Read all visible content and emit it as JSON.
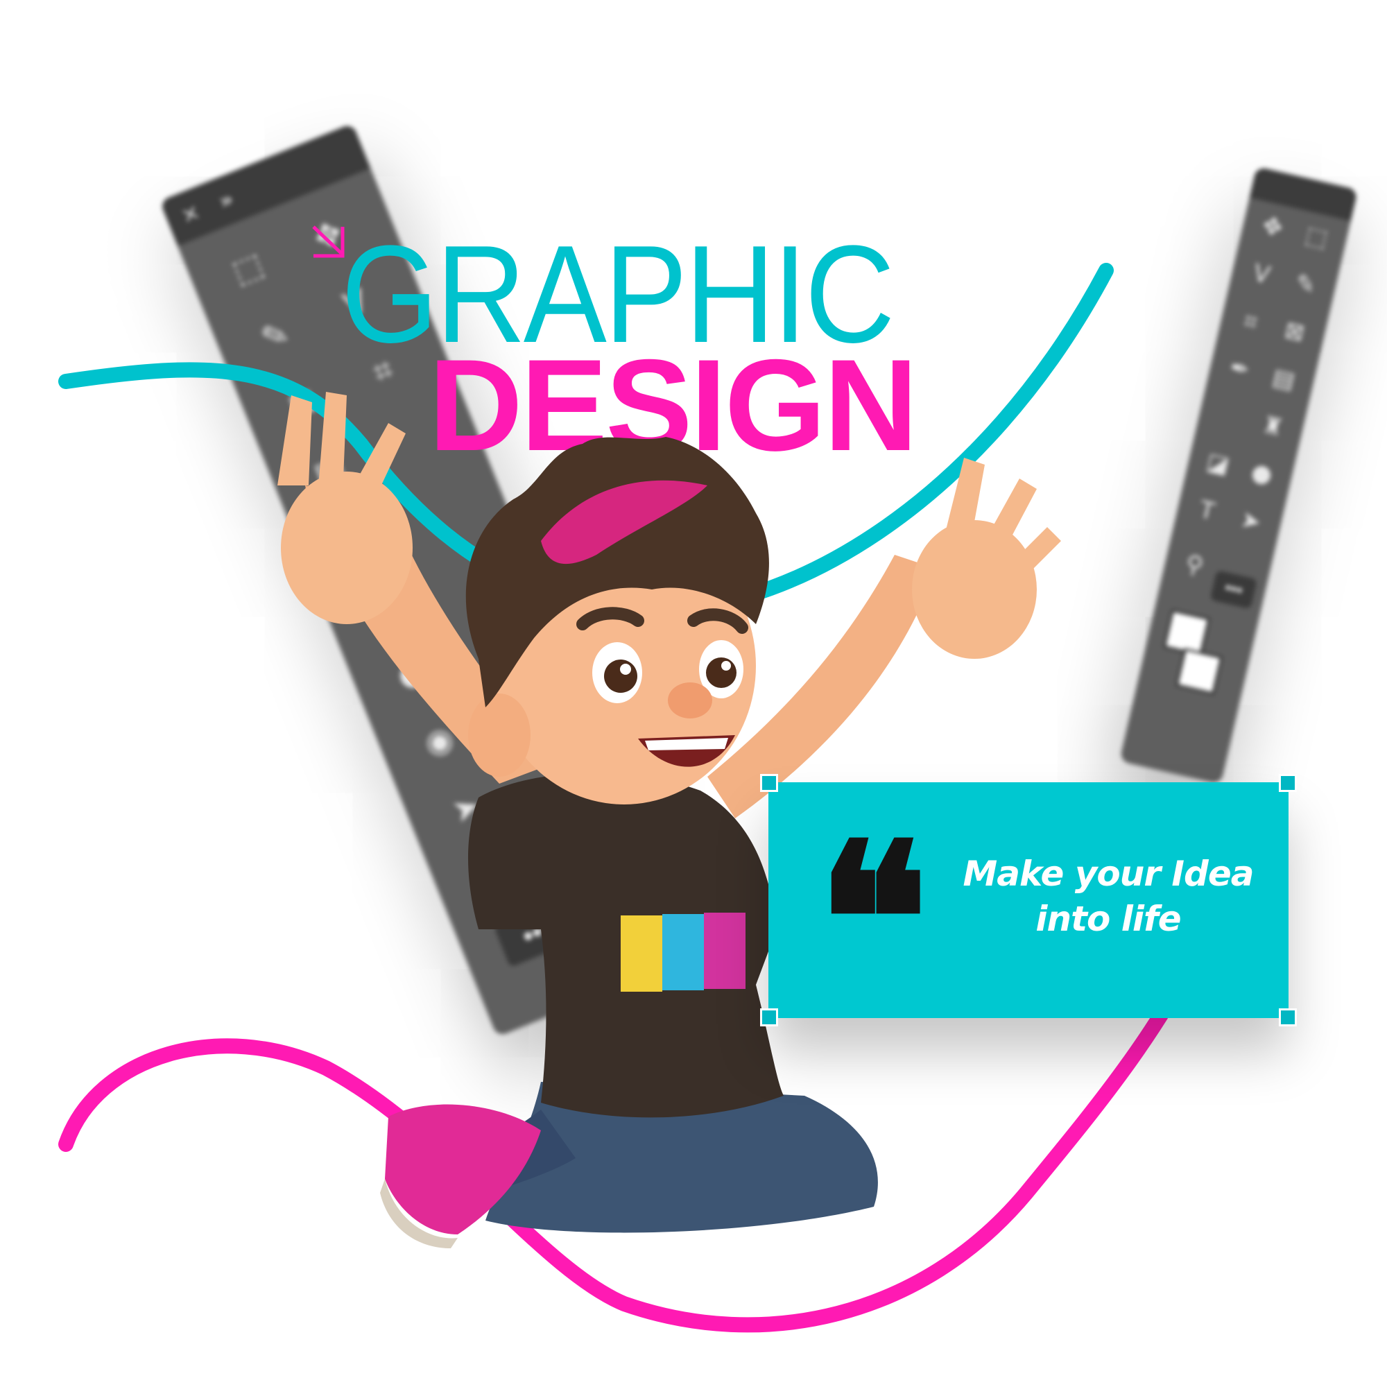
{
  "headline": {
    "line1": "GRAPHIC",
    "line2": "DESIGN"
  },
  "quote": {
    "mark": "❝",
    "text_line1": "Make your Idea",
    "text_line2": "into life"
  },
  "toolbars": {
    "left_more": "•••",
    "right_more": "•••",
    "left_expand": "»",
    "left_close": "✕"
  },
  "colors": {
    "cyan": "#00c2cd",
    "magenta": "#ff1ab3",
    "card": "#00c8d0",
    "toolbar_gray": "#5f5f5f"
  },
  "icons": [
    "arrow-down-right-icon",
    "quote-icon",
    "marquee-tool-icon",
    "move-tool-icon",
    "lasso-tool-icon",
    "crop-tool-icon",
    "brush-tool-icon",
    "eraser-tool-icon",
    "stamp-tool-icon",
    "drop-tool-icon",
    "eye-tool-icon",
    "pointer-tool-icon",
    "hand-tool-icon",
    "zoom-tool-icon",
    "text-tool-icon"
  ]
}
